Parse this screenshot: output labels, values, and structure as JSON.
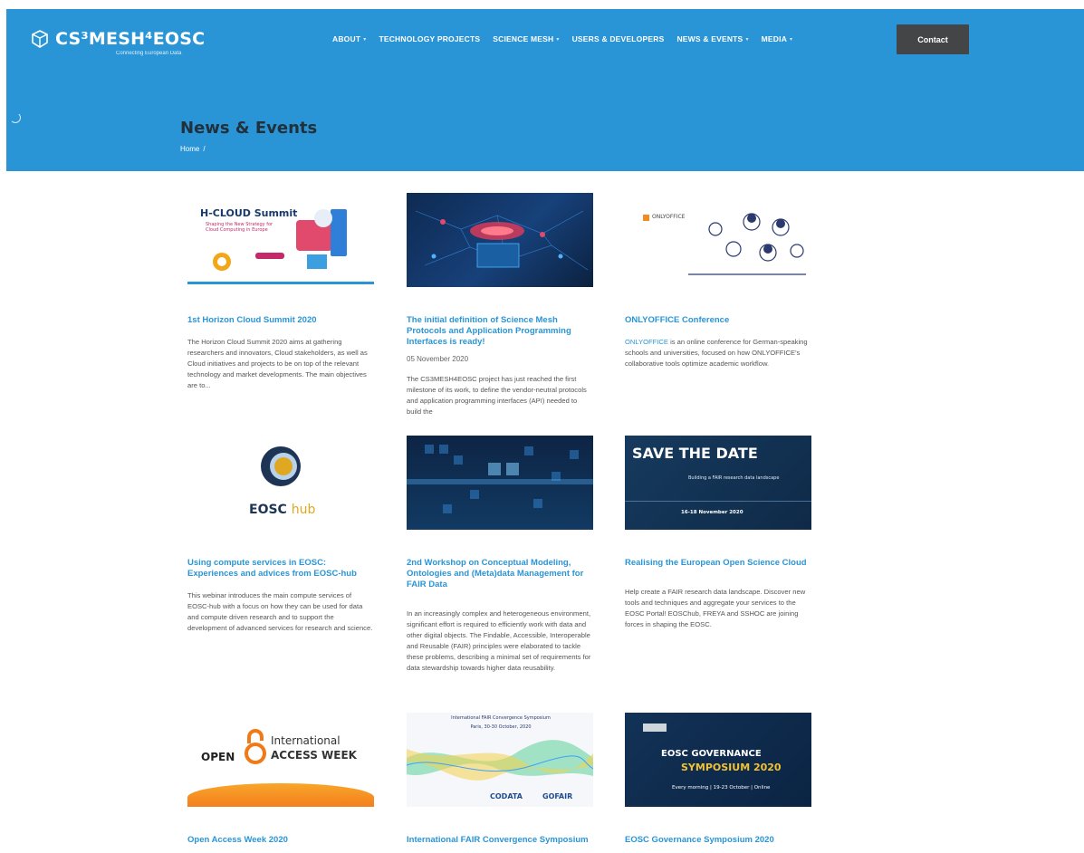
{
  "header": {
    "logo_text": "CS³MESH⁴EOSC",
    "logo_tagline": "Connecting European Data",
    "nav": [
      {
        "label": "ABOUT"
      },
      {
        "label": "TECHNOLOGY PROJECTS"
      },
      {
        "label": "SCIENCE MESH"
      },
      {
        "label": "USERS & DEVELOPERS"
      },
      {
        "label": "NEWS & EVENTS"
      },
      {
        "label": "MEDIA"
      }
    ],
    "contact_label": "Contact"
  },
  "hero": {
    "title": "News & Events",
    "breadcrumb_home": "Home",
    "breadcrumb_sep": "/"
  },
  "colors": {
    "brand_blue": "#2a95d6",
    "title_dark": "#22303a",
    "button_dark": "#444546"
  },
  "cards": [
    {
      "thumb_text": "H-CLOUD Summit",
      "thumb_sub": "Shaping the New Strategy for Cloud Computing in Europe",
      "title": "1st Horizon Cloud Summit 2020",
      "date": "",
      "excerpt": "The Horizon Cloud Summit 2020 aims at gathering researchers and innovators, Cloud stakeholders, as well as Cloud initiatives and projects to be on top of the relevant technology and market developments. The main objectives are to..."
    },
    {
      "title": "The initial definition of Science Mesh Protocols and Application Programming Interfaces is ready!",
      "date": "05 November 2020",
      "excerpt": "The CS3MESH4EOSC project has just reached the first milestone of its work, to define the vendor-neutral protocols and application programming interfaces (API) needed to build the"
    },
    {
      "thumb_text": "ONLYOFFICE",
      "title": "ONLYOFFICE Conference",
      "date": "",
      "excerpt_link": "ONLYOFFICE",
      "excerpt": " is an online conference for German-speaking schools and universities, focused on how ONLYOFFICE's collaborative tools optimize academic workflow."
    },
    {
      "thumb_text": "EOSC",
      "thumb_text2": "hub",
      "title": "Using compute services in EOSC: Experiences and advices from EOSC-hub",
      "date": "",
      "excerpt": "This webinar introduces the main compute services of EOSC-hub with a focus on how they can be used for data and compute driven research and to support the development of advanced services for research and science."
    },
    {
      "title": "2nd Workshop on Conceptual Modeling, Ontologies and (Meta)data Management for FAIR Data",
      "date": "",
      "excerpt": "In an increasingly complex and heterogeneous environment, significant effort is required to efficiently work with data and other digital objects. The Findable, Accessible, Interoperable and Reusable (FAIR) principles were elaborated to tackle these problems, describing a minimal set of requirements for data stewardship towards higher data reusability."
    },
    {
      "thumb_text": "SAVE THE DATE",
      "thumb_sub": "Building a FAIR research data landscape",
      "thumb_date": "16-18 November 2020",
      "title": "Realising the European Open Science Cloud",
      "date": "",
      "excerpt": "Help create a FAIR research data landscape. Discover new tools and techniques and aggregate your services to the EOSC Portal! EOSChub, FREYA and SSHOC are joining forces in shaping the EOSC."
    },
    {
      "thumb_text": "OPEN",
      "thumb_text2": "International",
      "thumb_text3": "ACCESS WEEK",
      "title": "Open Access Week 2020",
      "date": "",
      "excerpt": ""
    },
    {
      "thumb_text": "International FAIR Convergence Symposium",
      "thumb_sub": "Paris, 30-30 October, 2020",
      "thumb_logo1": "CODATA",
      "thumb_logo2": "GOFAIR",
      "title": "International FAIR Convergence Symposium",
      "date": "",
      "excerpt": ""
    },
    {
      "thumb_text": "EOSC GOVERNANCE",
      "thumb_text2": "SYMPOSIUM 2020",
      "thumb_sub": "Every morning | 19-23 October | Online",
      "title": "EOSC Governance Symposium 2020",
      "date": "",
      "excerpt": ""
    }
  ]
}
